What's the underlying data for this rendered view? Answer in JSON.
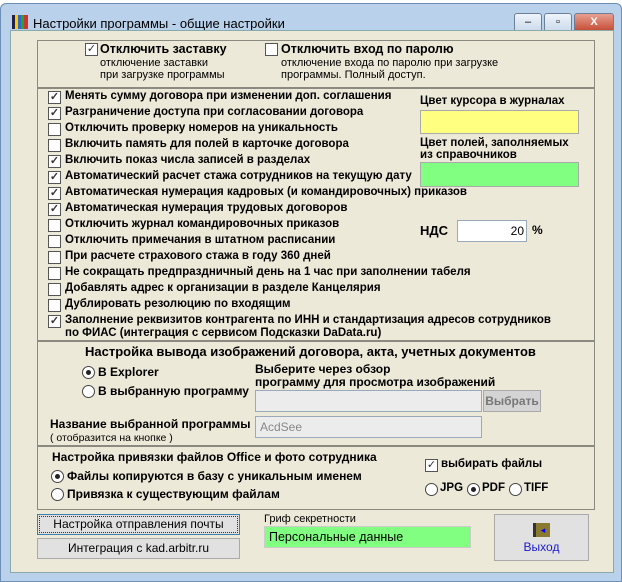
{
  "window": {
    "title": "Настройки программы - общие настройки",
    "minimize": "‒",
    "maximize": "▫",
    "close": "X"
  },
  "top": {
    "disable_splash": {
      "label": "Отключить заставку",
      "desc1": "отключение заставки",
      "desc2": "при загрузке программы",
      "checked": true
    },
    "disable_password": {
      "label": "Отключить вход по паролю",
      "desc1": "отключение входа по паролю при загрузке",
      "desc2": "программы. Полный доступ.",
      "checked": false
    }
  },
  "options": [
    {
      "label": "Менять сумму договора при изменении доп. соглашения",
      "checked": true
    },
    {
      "label": "Разграничение доступа при согласовании договора",
      "checked": true
    },
    {
      "label": "Отключить проверку номеров на уникальность",
      "checked": false
    },
    {
      "label": "Включить память для полей в карточке договора",
      "checked": false
    },
    {
      "label": "Включить показ числа записей в разделах",
      "checked": true
    },
    {
      "label": "Автоматический расчет стажа сотрудников на текущую дату",
      "checked": true
    },
    {
      "label": "Автоматическая нумерация кадровых (и командировочных) приказов",
      "checked": true
    },
    {
      "label": "Автоматическая нумерация трудовых договоров",
      "checked": true
    },
    {
      "label": "Отключить журнал командировочных приказов",
      "checked": false
    },
    {
      "label": "Отключить примечания в штатном расписании",
      "checked": false
    },
    {
      "label": "При расчете страхового стажа в году 360 дней",
      "checked": false
    },
    {
      "label": "Не сокращать предпраздничный день на 1 час при заполнении табеля",
      "checked": false
    },
    {
      "label": "Добавлять адрес к организации в разделе Канцелярия",
      "checked": false
    },
    {
      "label": "Дублировать резолюцию по входящим",
      "checked": false
    },
    {
      "label": "Заполнение реквизитов контрагента по ИНН и стандартизация адресов сотрудников",
      "label2": "по ФИАС (интеграция с сервисом Подсказки DaData.ru)",
      "checked": true
    }
  ],
  "colors": {
    "cursor_label": "Цвет курсора в журналах",
    "cursor_color": "#ffff80",
    "fields_label1": "Цвет полей, заполняемых",
    "fields_label2": "из справочников",
    "fields_color": "#80ff80"
  },
  "vat": {
    "label": "НДС",
    "value": "20",
    "unit": "%"
  },
  "images": {
    "heading": "Настройка вывода изображений договора,  акта, учетных документов",
    "opt_explorer": "В Explorer",
    "opt_program": "В выбранную программу",
    "selected": "explorer",
    "browse_hint1": "Выберите через обзор",
    "browse_hint2": "программу для просмотра изображений",
    "path_value": "",
    "browse_button": "Выбрать",
    "name_label": "Название выбранной программы",
    "name_hint": "( отобразится на кнопке )",
    "name_value": "AcdSee"
  },
  "files": {
    "heading": "Настройка привязки файлов Office и фото сотрудника",
    "opt_copy": "Файлы копируются в базу с уникальным именем",
    "opt_link": "Привязка к существующим файлам",
    "selected": "copy",
    "choose_files": "выбирать файлы",
    "choose_checked": true,
    "fmt_jpg": "JPG",
    "fmt_pdf": "PDF",
    "fmt_tiff": "TIFF",
    "format": "PDF"
  },
  "bottom": {
    "mail_button": "Настройка отправления почты",
    "kad_button": "Интеграция с kad.arbitr.ru",
    "secrecy_label": "Гриф секретности",
    "secrecy_value": "Персональные данные",
    "exit_button": "Выход"
  }
}
